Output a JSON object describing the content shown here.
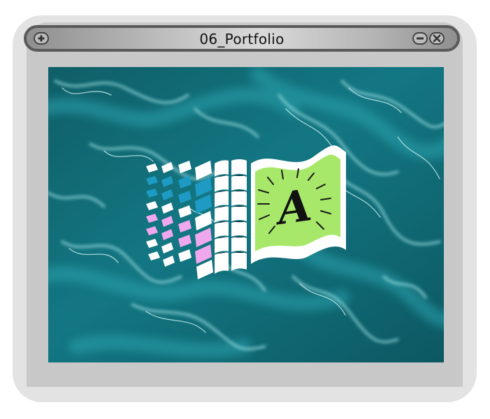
{
  "window": {
    "title": "06_Portfolio",
    "buttons": {
      "plus": "plus-icon",
      "minimize": "minimize-icon",
      "close": "close-icon"
    }
  },
  "artwork": {
    "logo_letter": "A",
    "colors": {
      "water_dark": "#0d5a63",
      "water_mid": "#1a8a96",
      "water_light": "#8fd8de",
      "flag_green": "#a7e86a",
      "tile_blue": "#1e9bc4",
      "tile_pink": "#f0a8ec",
      "tile_white": "#ffffff"
    }
  }
}
